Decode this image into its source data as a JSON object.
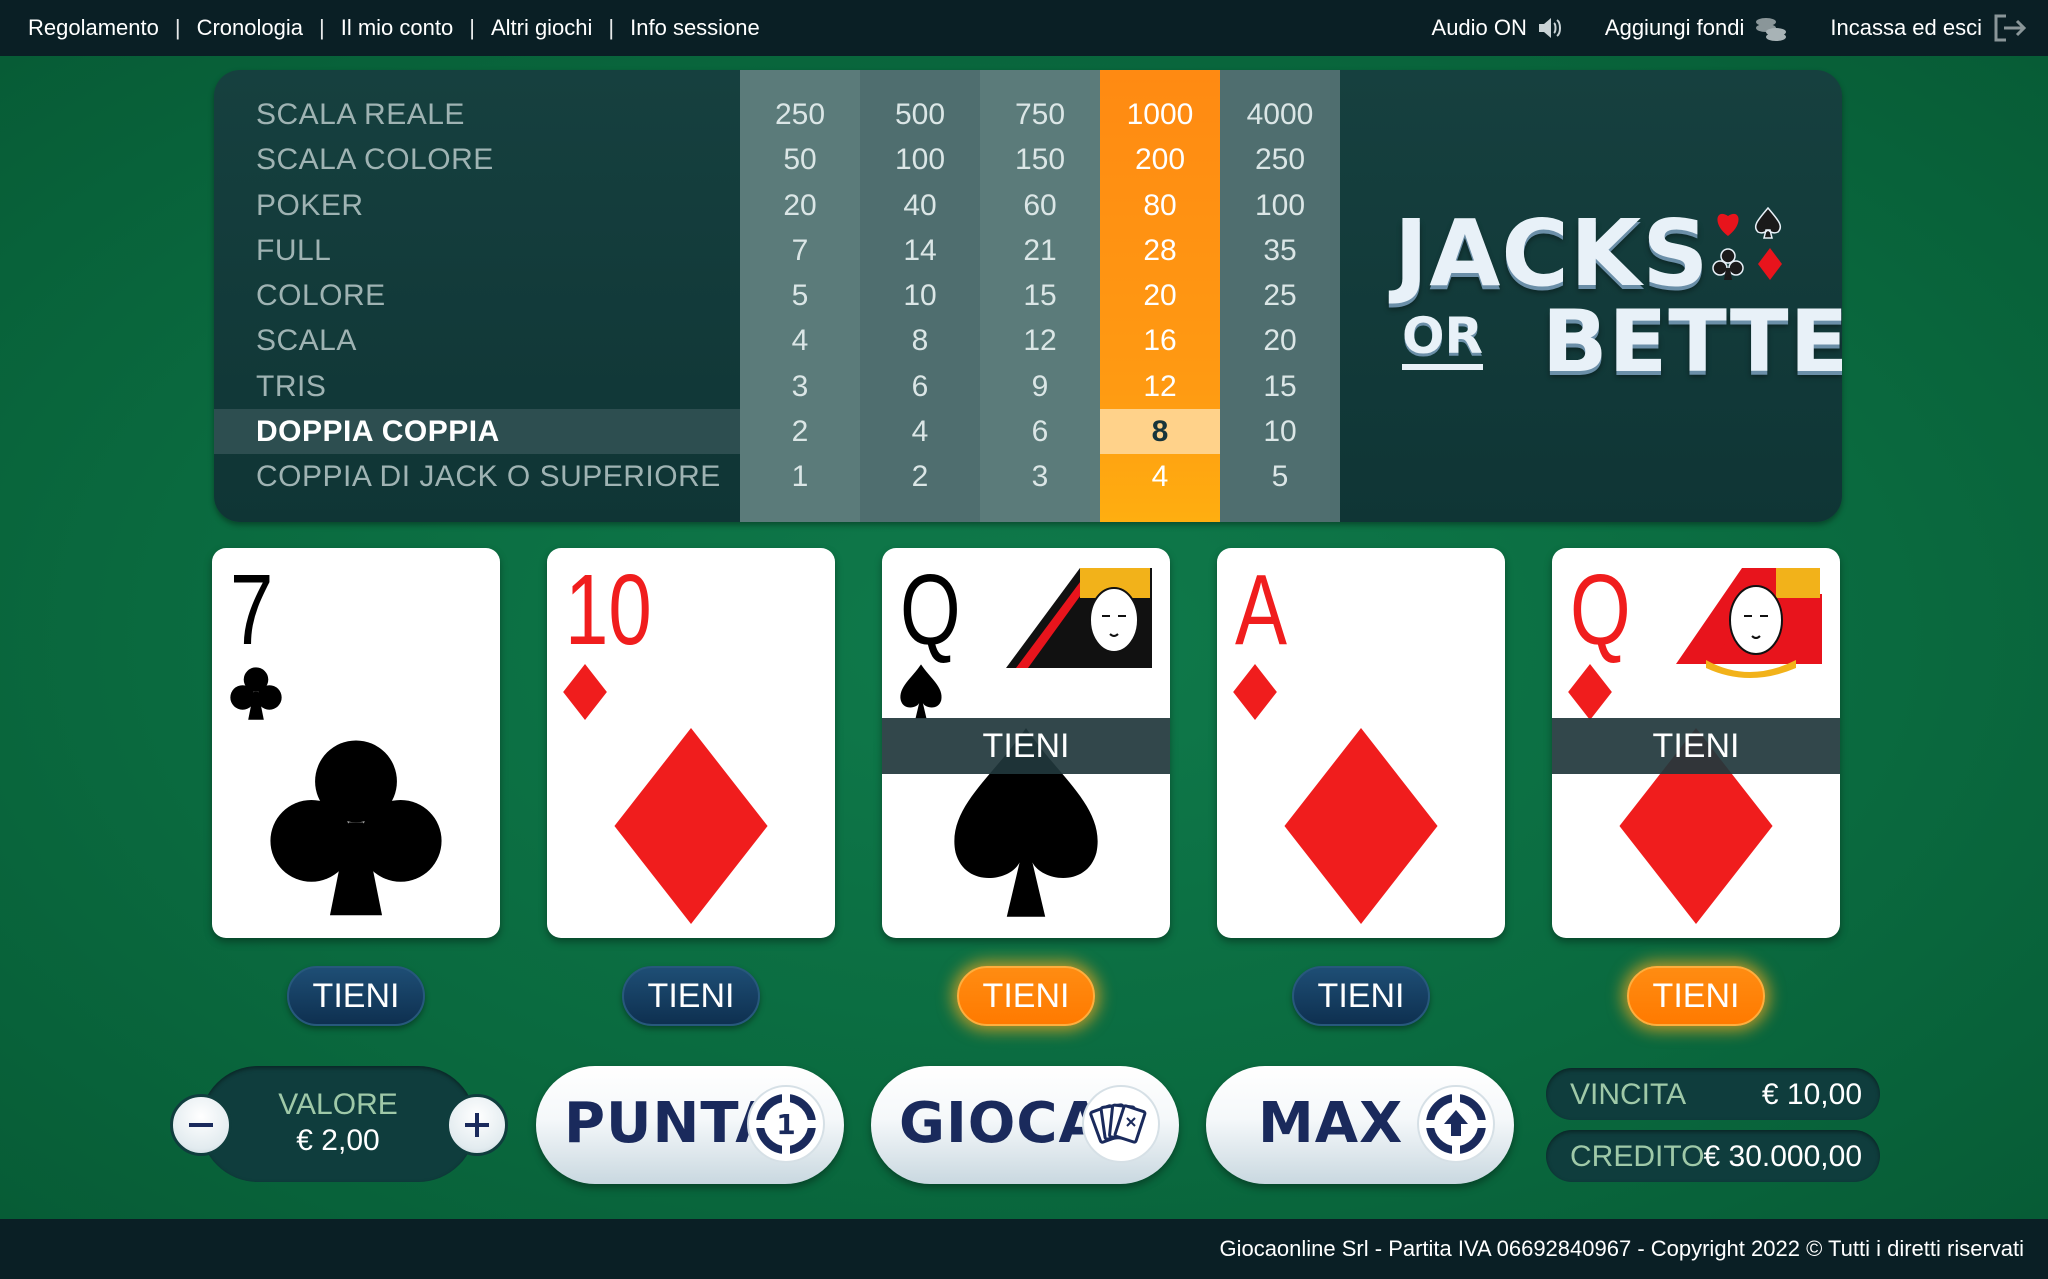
{
  "topbar": {
    "nav": [
      "Regolamento",
      "Cronologia",
      "Il mio conto",
      "Altri giochi",
      "Info sessione"
    ],
    "audio_label": "Audio ON",
    "add_funds_label": "Aggiungi fondi",
    "cashout_label": "Incassa ed esci"
  },
  "paytable": {
    "hands": [
      "SCALA REALE",
      "SCALA COLORE",
      "POKER",
      "FULL",
      "COLORE",
      "SCALA",
      "TRIS",
      "DOPPIA COPPIA",
      "COPPIA DI JACK O SUPERIORE"
    ],
    "highlighted_hand_index": 7,
    "active_column_index": 3,
    "columns": [
      [
        "250",
        "50",
        "20",
        "7",
        "5",
        "4",
        "3",
        "2",
        "1"
      ],
      [
        "500",
        "100",
        "40",
        "14",
        "10",
        "8",
        "6",
        "4",
        "2"
      ],
      [
        "750",
        "150",
        "60",
        "21",
        "15",
        "12",
        "9",
        "6",
        "3"
      ],
      [
        "1000",
        "200",
        "80",
        "28",
        "20",
        "16",
        "12",
        "8",
        "4"
      ],
      [
        "4000",
        "250",
        "100",
        "35",
        "25",
        "20",
        "15",
        "10",
        "5"
      ]
    ]
  },
  "logo": {
    "line1": "JACKS",
    "or": "OR",
    "line2": "BETTER"
  },
  "cards": [
    {
      "rank": "7",
      "suit": "clubs",
      "held": false
    },
    {
      "rank": "10",
      "suit": "diamonds",
      "held": false
    },
    {
      "rank": "Q",
      "suit": "spades",
      "held": true
    },
    {
      "rank": "A",
      "suit": "diamonds",
      "held": false
    },
    {
      "rank": "Q",
      "suit": "diamonds",
      "held": true
    }
  ],
  "held_label": "TIENI",
  "hold_button_label": "TIENI",
  "controls": {
    "bet_label": "VALORE",
    "bet_value": "€ 2,00",
    "bet_button": "PUNTA",
    "play_button": "GIOCA",
    "max_button": "MAX",
    "bet_icon_text": "1"
  },
  "stats": {
    "win_label": "VINCITA",
    "win_value": "€ 10,00",
    "credit_label": "CREDITO",
    "credit_value": "€ 30.000,00"
  },
  "footer": "Giocaonline Srl - Partita IVA 06692840967 - Copyright 2022 © Tutti i diretti riservati",
  "colors": {
    "felt": "#0c6e43",
    "bar": "#0a1f25",
    "active_column": "#ff8a12",
    "hold_active": "#ff8c12",
    "hold_idle": "#1e4e75"
  }
}
